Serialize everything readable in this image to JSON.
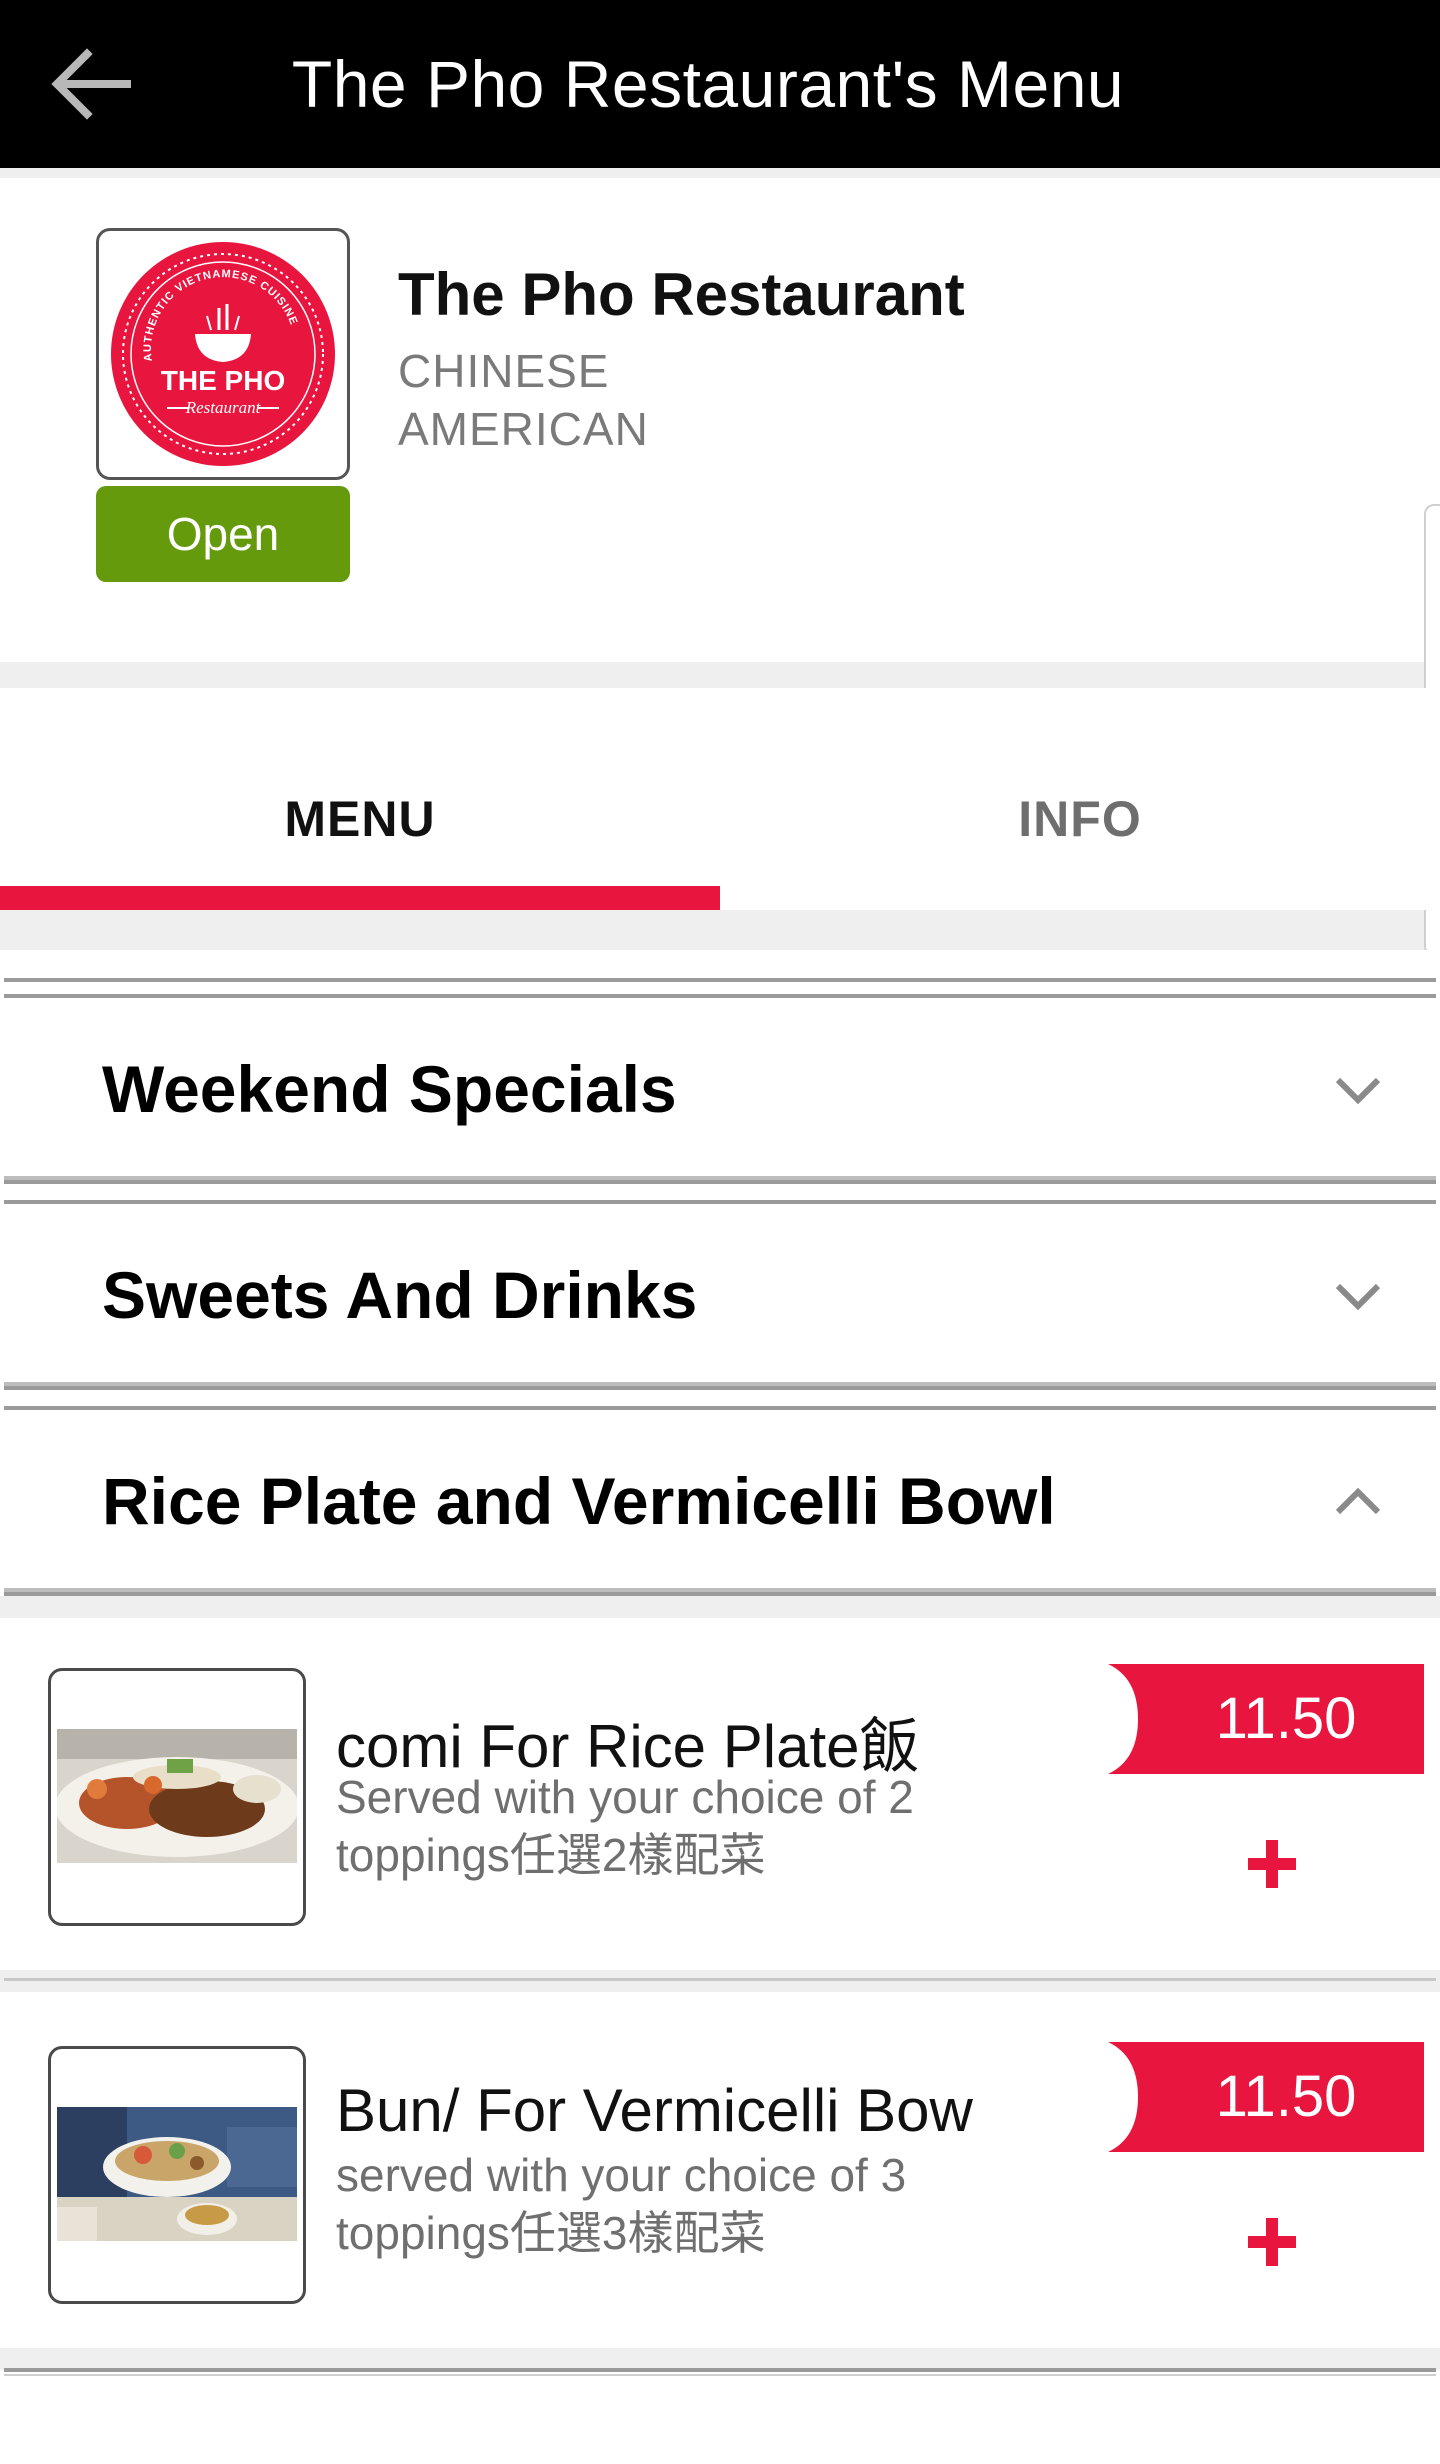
{
  "header": {
    "title": "The Pho Restaurant's Menu",
    "back_icon": "arrow-left-icon"
  },
  "restaurant": {
    "name": "The Pho Restaurant",
    "cuisines": [
      "CHINESE",
      "AMERICAN"
    ],
    "status": "Open",
    "status_color": "#649a0c",
    "logo": {
      "main_text": "THE PHO",
      "script_text": "Restaurant",
      "arc_text": "AUTHENTIC VIETNAMESE CUISINE",
      "color": "#e8163e"
    }
  },
  "tabs": [
    {
      "label": "MENU",
      "active": true
    },
    {
      "label": "INFO",
      "active": false
    }
  ],
  "accent_color": "#e8163e",
  "categories": [
    {
      "title": "Weekend Specials",
      "expanded": false,
      "chevron_icon": "chevron-down-icon"
    },
    {
      "title": "Sweets And Drinks",
      "expanded": false,
      "chevron_icon": "chevron-down-icon"
    },
    {
      "title": "Rice Plate and Vermicelli Bowl",
      "expanded": true,
      "chevron_icon": "chevron-up-icon"
    }
  ],
  "items": [
    {
      "name": "comi For Rice Plate飯",
      "description": "Served with your choice of 2 toppings任選2樣配菜",
      "price": "11.50",
      "add_icon": "plus-icon"
    },
    {
      "name": "Bun/ For Vermicelli Bow",
      "description": "served with your choice of 3 toppings任選3樣配菜",
      "price": "11.50",
      "add_icon": "plus-icon"
    }
  ]
}
